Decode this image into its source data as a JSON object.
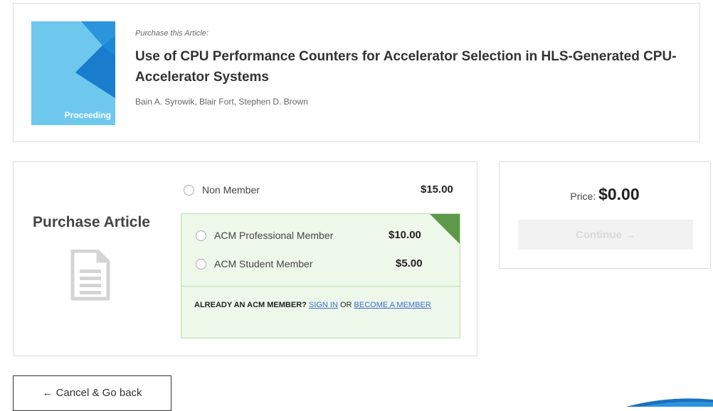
{
  "article": {
    "kicker": "Purchase this Article:",
    "title": "Use of CPU Performance Counters for Accelerator Selection in HLS-Generated CPU-Accelerator Systems",
    "authors": "Bain A. Syrowik, Blair Fort, Stephen D. Brown",
    "cover_label": "Proceeding"
  },
  "purchase": {
    "heading": "Purchase Article",
    "options": [
      {
        "label": "Non Member",
        "price": "$15.00",
        "selected": false
      },
      {
        "label": "ACM Professional Member",
        "price": "$10.00",
        "selected": false
      },
      {
        "label": "ACM Student Member",
        "price": "$5.00",
        "selected": false
      }
    ],
    "member_prompt": "ALREADY AN ACM MEMBER?",
    "sign_in": "SIGN IN",
    "or": "OR",
    "become_member": "BECOME A MEMBER"
  },
  "summary": {
    "price_label": "Price:",
    "price_value": "$0.00",
    "continue_label": "Continue →"
  },
  "navigation": {
    "cancel_label": "← Cancel & Go back"
  },
  "colors": {
    "cover_bg": "#6ec8ee",
    "cover_accent": "#1e88d8",
    "member_box_bg": "#eef8ea",
    "member_corner": "#5c9a4a",
    "link": "#3a6fd0"
  }
}
